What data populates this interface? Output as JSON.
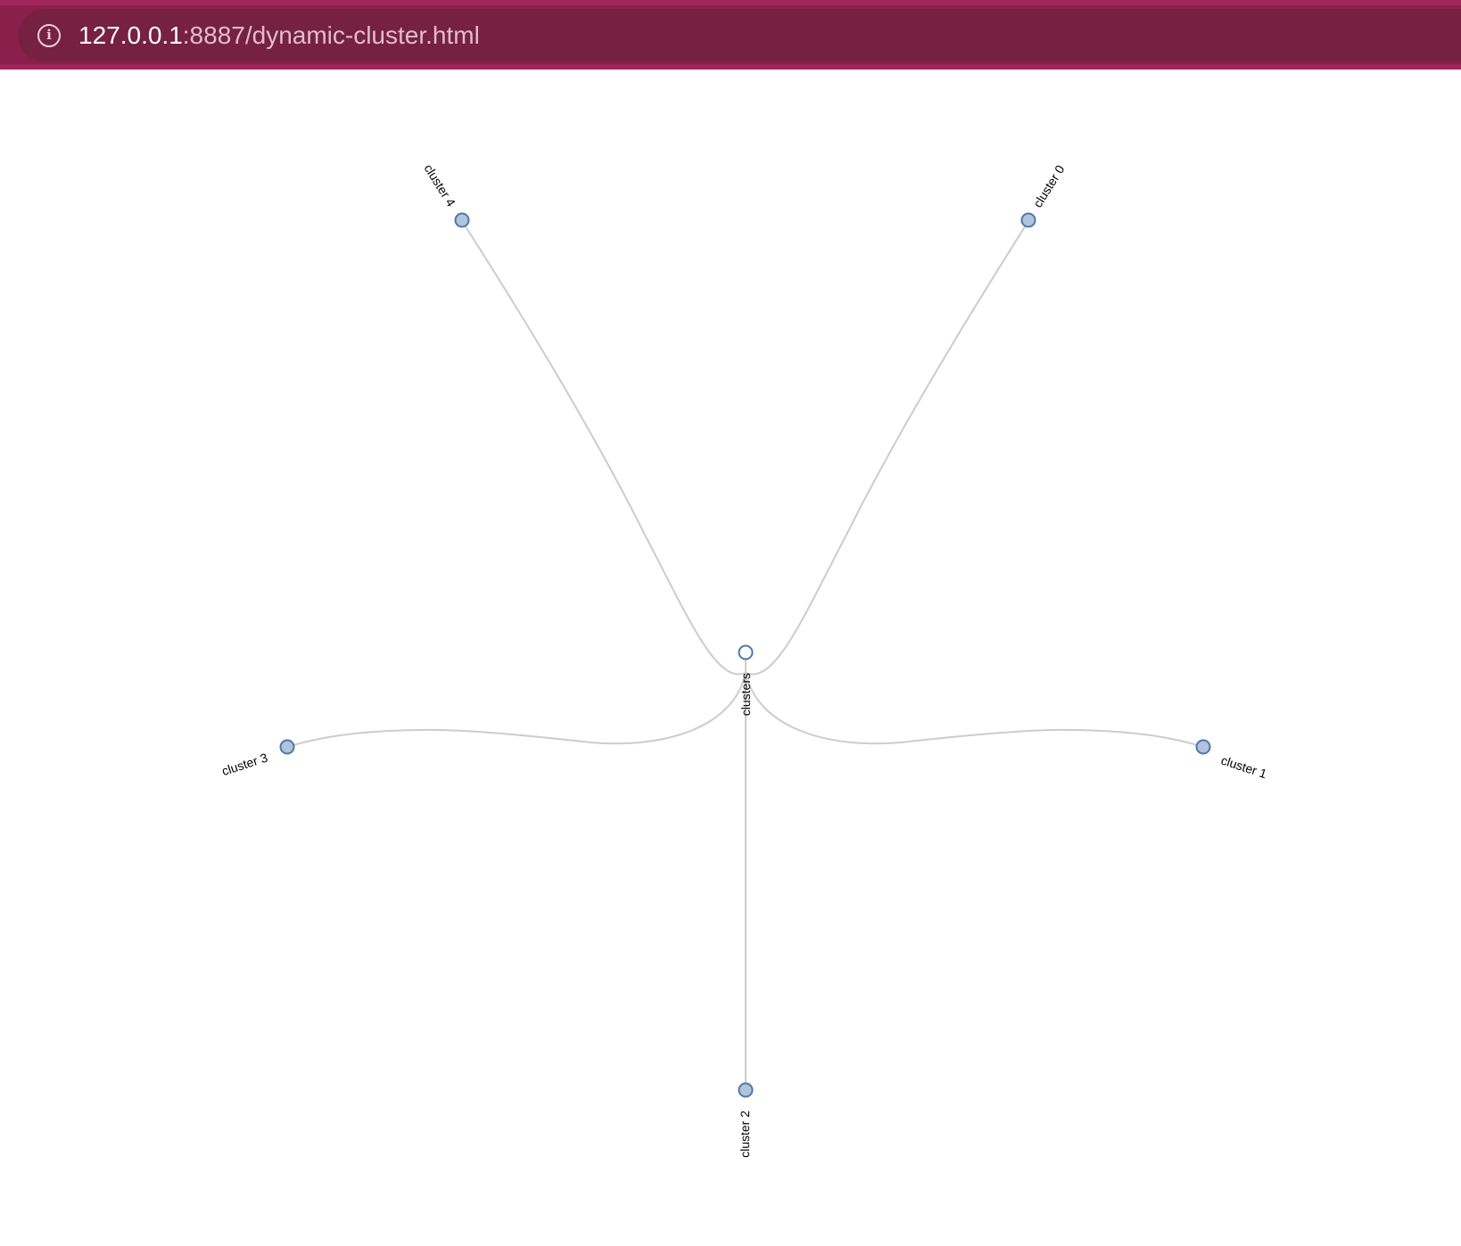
{
  "browser": {
    "url_host": "127.0.0.1",
    "url_rest": ":8887/dynamic-cluster.html",
    "info_icon": "info-icon"
  },
  "tree": {
    "root": {
      "label": "clusters",
      "collapsed": false
    },
    "children": [
      {
        "label": "cluster 0"
      },
      {
        "label": "cluster 1"
      },
      {
        "label": "cluster 2"
      },
      {
        "label": "cluster 3"
      },
      {
        "label": "cluster 4"
      }
    ]
  },
  "colors": {
    "link": "#cccccc",
    "node_stroke": "#4e77a8",
    "node_fill_collapsed": "#b0c4de",
    "node_fill_root": "#ffffff",
    "browser_bar": "#8b1f4c",
    "url_pill": "#762141"
  }
}
